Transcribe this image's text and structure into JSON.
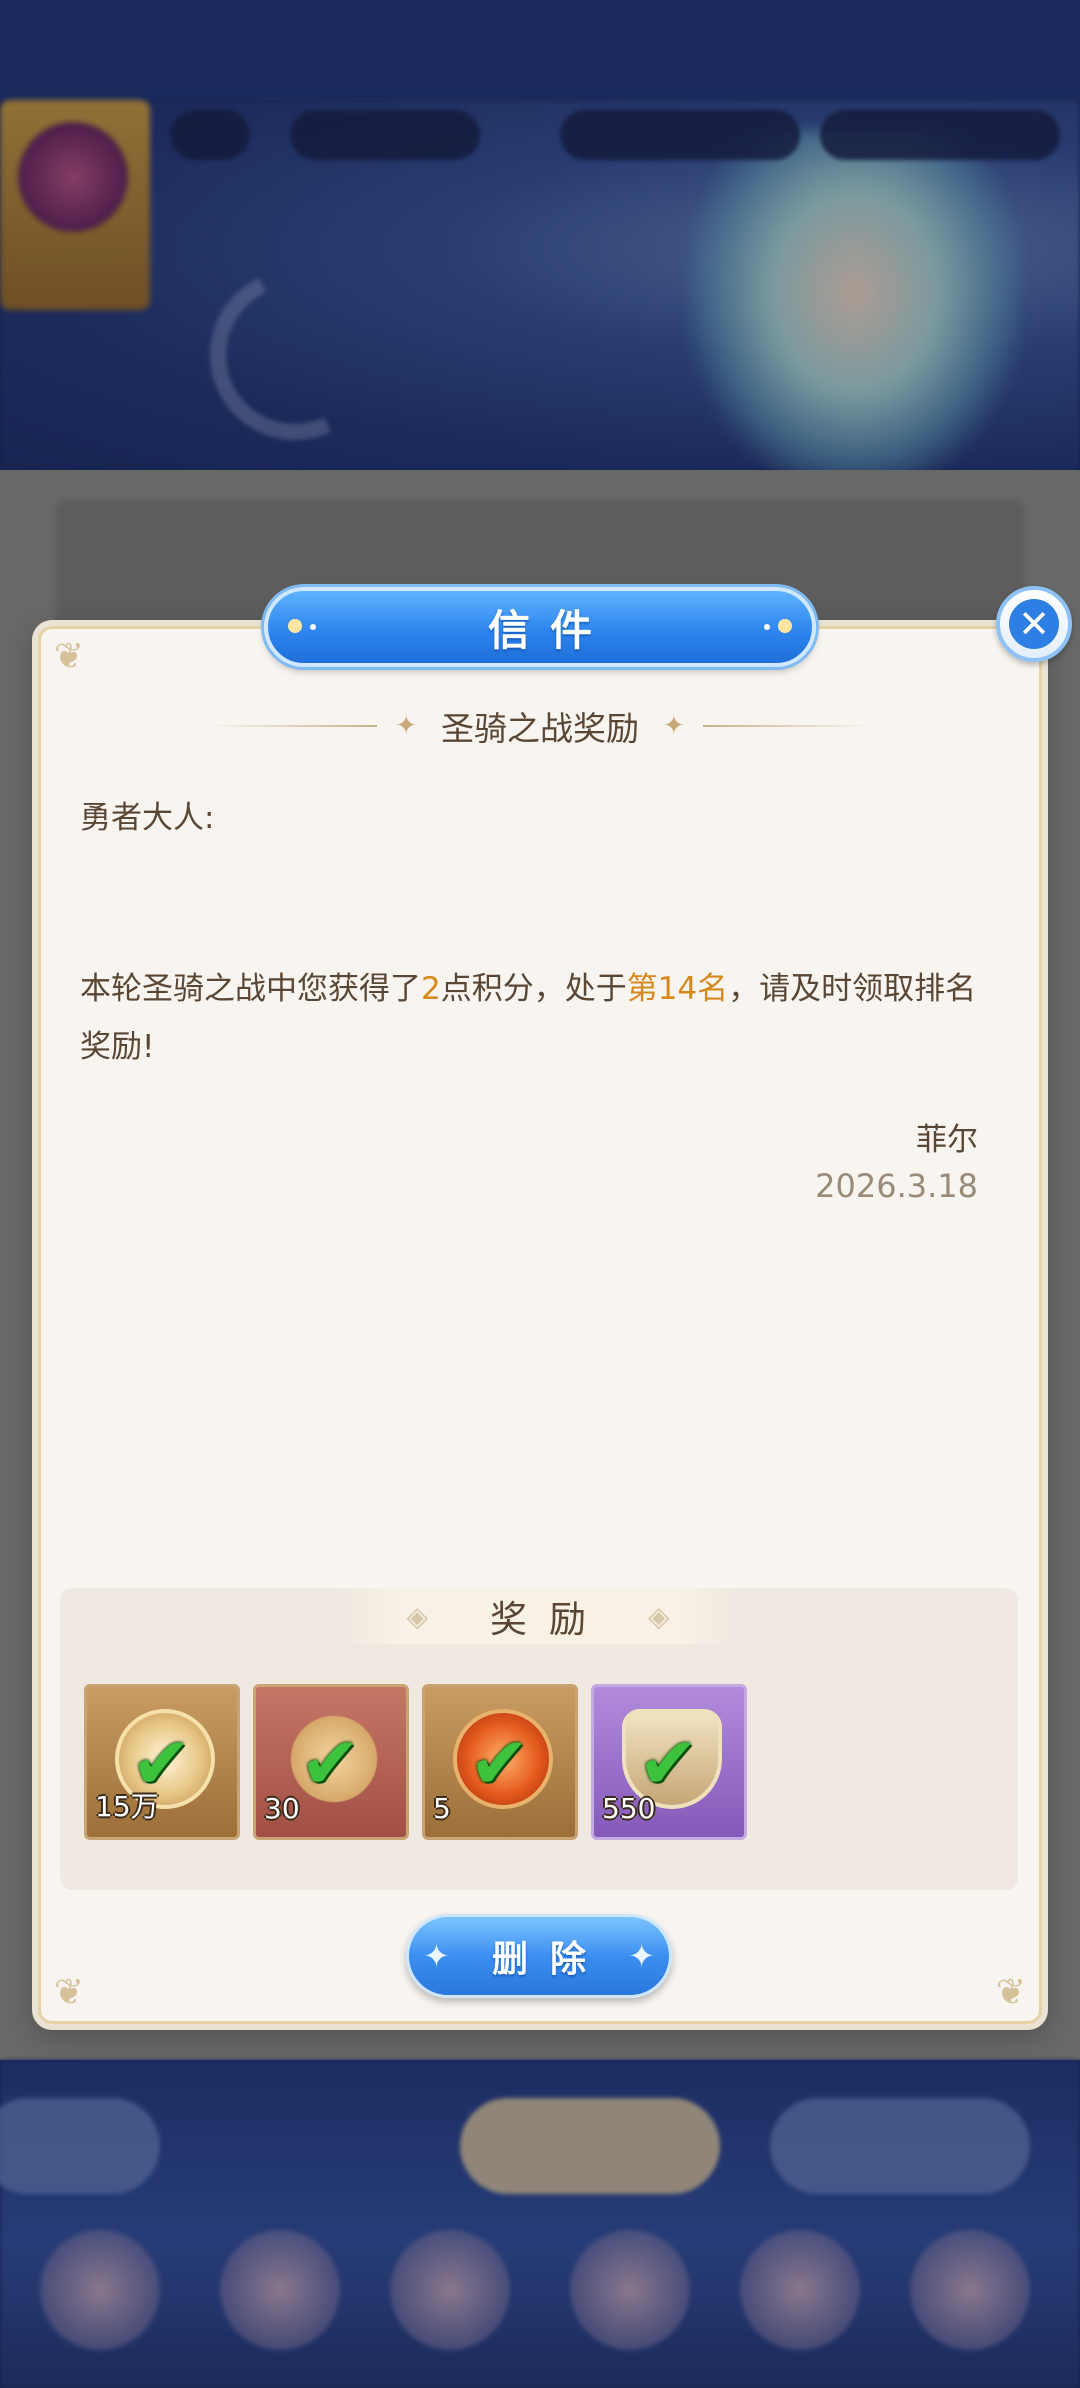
{
  "modal": {
    "title": "信件",
    "subject": "圣骑之战奖励",
    "greeting": "勇者大人:",
    "body": {
      "part1": "本轮圣骑之战中您获得了",
      "points": "2",
      "part2": "点积分，处于",
      "rank": "第14名",
      "part3": "，请及时领取排名奖励!"
    },
    "signature": "菲尔",
    "date": "2026.3.18",
    "rewards_label": "奖励",
    "rewards": [
      {
        "icon": "gold-coin-icon",
        "count": "15万",
        "claimed": true
      },
      {
        "icon": "golden-dragon-icon",
        "count": "30",
        "claimed": true
      },
      {
        "icon": "fire-orb-icon",
        "count": "5",
        "claimed": true
      },
      {
        "icon": "winged-badge-icon",
        "count": "550",
        "claimed": true
      }
    ],
    "delete_label": "删除"
  },
  "colors": {
    "accent_blue": "#2e86ee",
    "highlight_orange": "#d6891c",
    "text_brown": "#5a4634",
    "claimed_check_green": "#3cc23c"
  }
}
